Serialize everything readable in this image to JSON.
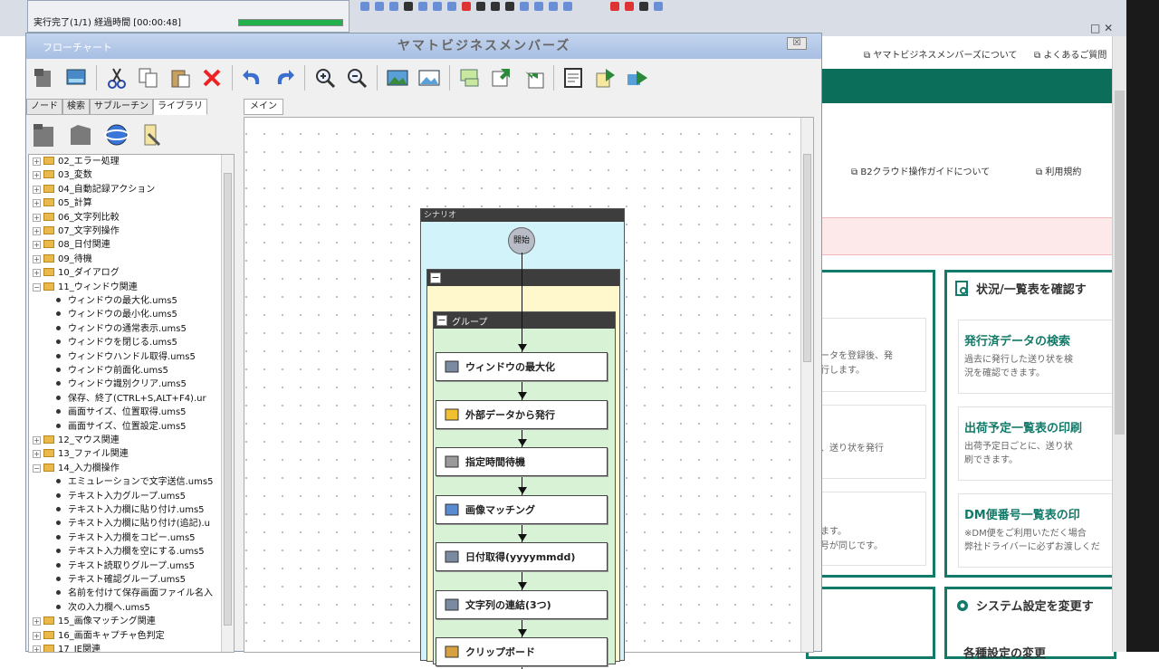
{
  "status": {
    "text": "実行完了(1/1) 経過時間 [00:00:48]",
    "progress": 1.0
  },
  "browser": {
    "links": {
      "about": "ヤマトビジネスメンバーズについて",
      "faq": "よくあるご質問",
      "guide": "B2クラウド操作ガイドについて",
      "terms": "利用規約"
    },
    "section_status": {
      "heading": "状況/一覧表を確認す",
      "items": [
        {
          "title": "発行済データの検索",
          "desc1": "過去に発行した送り状を検",
          "desc2": "況を確認できます。"
        },
        {
          "title": "出荷予定一覧表の印刷",
          "desc1": "出荷予定日ごとに、送り状",
          "desc2": "刷できます。"
        },
        {
          "title": "DM便番号一覧表の印",
          "desc1": "※DM便をご利用いただく場合",
          "desc2": "弊社ドライバーに必ずお渡しくだ"
        }
      ]
    },
    "left_fragments": [
      "ータを登録後、発",
      "行します。",
      "、送り状を発行",
      "ます。",
      "号が同じです。"
    ],
    "section_settings": {
      "heading": "システム設定を変更す",
      "item_title": "各種設定の変更"
    }
  },
  "flowchart": {
    "title": "フローチャート",
    "ghost_title": "ヤマトビジネスメンバーズ",
    "close_label": "☒",
    "tabs": [
      "ノード",
      "検索",
      "サブルーチン",
      "ライブラリ"
    ],
    "canvas_tab": "メイン",
    "scenario_label": "シナリオ",
    "start_label": "開始",
    "group_label": "グループ",
    "nodes": [
      "ウィンドウの最大化",
      "外部データから発行",
      "指定時間待機",
      "画像マッチング",
      "日付取得(yyyymmdd)",
      "文字列の連結(3つ)",
      "クリップボード"
    ]
  },
  "tree": [
    {
      "type": "folder",
      "label": "02_エラー処理"
    },
    {
      "type": "folder",
      "label": "03_変数"
    },
    {
      "type": "folder",
      "label": "04_自動記録アクション"
    },
    {
      "type": "folder",
      "label": "05_計算"
    },
    {
      "type": "folder",
      "label": "06_文字列比較"
    },
    {
      "type": "folder",
      "label": "07_文字列操作"
    },
    {
      "type": "folder",
      "label": "08_日付関連"
    },
    {
      "type": "folder",
      "label": "09_待機"
    },
    {
      "type": "folder",
      "label": "10_ダイアログ"
    },
    {
      "type": "folder-open",
      "label": "11_ウィンドウ関連"
    },
    {
      "type": "item",
      "label": "ウィンドウの最大化.ums5"
    },
    {
      "type": "item",
      "label": "ウィンドウの最小化.ums5"
    },
    {
      "type": "item",
      "label": "ウィンドウの通常表示.ums5"
    },
    {
      "type": "item",
      "label": "ウィンドウを閉じる.ums5"
    },
    {
      "type": "item",
      "label": "ウィンドウハンドル取得.ums5"
    },
    {
      "type": "item",
      "label": "ウィンドウ前面化.ums5"
    },
    {
      "type": "item",
      "label": "ウィンドウ識別クリア.ums5"
    },
    {
      "type": "item",
      "label": "保存、終了(CTRL+S,ALT+F4).ur"
    },
    {
      "type": "item",
      "label": "画面サイズ、位置取得.ums5"
    },
    {
      "type": "item",
      "label": "画面サイズ、位置設定.ums5"
    },
    {
      "type": "folder",
      "label": "12_マウス関連"
    },
    {
      "type": "folder",
      "label": "13_ファイル関連"
    },
    {
      "type": "folder-open",
      "label": "14_入力欄操作"
    },
    {
      "type": "item",
      "label": "エミュレーションで文字送信.ums5"
    },
    {
      "type": "item",
      "label": "テキスト入力グループ.ums5"
    },
    {
      "type": "item",
      "label": "テキスト入力欄に貼り付け.ums5"
    },
    {
      "type": "item",
      "label": "テキスト入力欄に貼り付け(追記).u"
    },
    {
      "type": "item",
      "label": "テキスト入力欄をコピー.ums5"
    },
    {
      "type": "item",
      "label": "テキスト入力欄を空にする.ums5"
    },
    {
      "type": "item",
      "label": "テキスト読取りグループ.ums5"
    },
    {
      "type": "item",
      "label": "テキスト確認グループ.ums5"
    },
    {
      "type": "item",
      "label": "名前を付けて保存画面ファイル名入"
    },
    {
      "type": "item",
      "label": "次の入力欄へ.ums5"
    },
    {
      "type": "folder",
      "label": "15_画像マッチング関連"
    },
    {
      "type": "folder",
      "label": "16_画面キャプチャ色判定"
    },
    {
      "type": "folder",
      "label": "17_IE関連"
    }
  ]
}
